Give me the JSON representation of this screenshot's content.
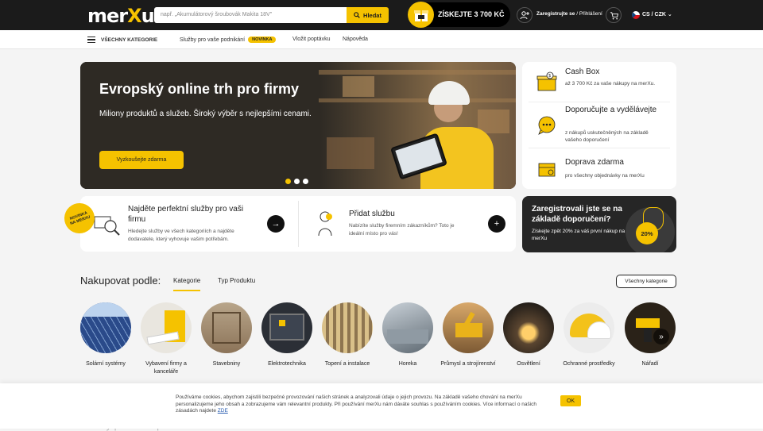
{
  "header": {
    "logo": "merXu",
    "search_placeholder": "např. „Akumulátorový šroubovák Makita 18V\"",
    "search_button": "Hledat",
    "cashbox_label": "ZÍSKEJTE 3 700 KČ",
    "register_label": "Zaregistrujte se",
    "login_label": "Přihlášení",
    "separator": "/",
    "currency": "CS / CZK"
  },
  "nav": {
    "categories": "VŠECHNY KATEGORIE",
    "services": "Služby pro vaše podnikání",
    "services_badge": "NOVINKA",
    "inquiry": "Vložit poptávku",
    "help": "Nápověda"
  },
  "hero": {
    "title": "Evropský online trh pro firmy",
    "subtitle": "Miliony produktů a služeb. Široký výběr s nejlepšími cenami.",
    "button": "Vyzkoušejte zdarma",
    "slides": 3,
    "active_slide": 1
  },
  "benefits": [
    {
      "title": "Cash Box",
      "text": "až 3 700 Kč za vaše nákupy na merXu."
    },
    {
      "title": "Doporučujte a vydělávejte",
      "text": "z nákupů uskutečněných na základě vašeho doporučení"
    },
    {
      "title": "Doprava zdarma",
      "text": "pro všechny objednávky na merXu"
    }
  ],
  "cards": [
    {
      "title": "Najděte perfektní služby pro vaši firmu",
      "text": "Hledejte služby ve všech kategoriích a najděte dodavatele, který vyhovuje vašim potřebám.",
      "button": "→"
    },
    {
      "title": "Přidat službu",
      "text": "Nabízíte služby firemním zákazníkům? Toto je ideální místo pro vás!",
      "button": "+"
    }
  ],
  "novinka_badge": {
    "line1": "NOVINKA",
    "line2": "NA MERXU"
  },
  "promo": {
    "title": "Zaregistrovali jste se na základě doporučení?",
    "text": "Získejte zpět 20% za váš první nákup na merXu",
    "badge": "20%"
  },
  "shop": {
    "title": "Nakupovat podle:",
    "tab_categories": "Kategorie",
    "tab_type": "Typ Produktu",
    "all_button": "Všechny kategorie",
    "categories": [
      {
        "label": "Solární systémy"
      },
      {
        "label": "Vybavení firmy a kanceláře"
      },
      {
        "label": "Stavebniny"
      },
      {
        "label": "Elektrotechnika"
      },
      {
        "label": "Topení a instalace"
      },
      {
        "label": "Horeka"
      },
      {
        "label": "Průmysl a strojírenství"
      },
      {
        "label": "Osvětlení"
      },
      {
        "label": "Ochranné prostředky"
      },
      {
        "label": "Nářadí"
      }
    ],
    "next": "»"
  },
  "cookie": {
    "text": "Používáme cookies, abychom zajistili bezpečné provozování našich stránek a analyzovali údaje o jejich provozu. Na základě vašeho chování na merXu personalizujeme jeho obsah a zobrazujeme vám relevantní produkty. Při používání merXu nám dáváte souhlas s používáním cookies. Více informací o našich zásadách najdete",
    "link": "ZDE",
    "ok": "OK"
  },
  "below_fold_title": "Služby pro vaše podnikání"
}
